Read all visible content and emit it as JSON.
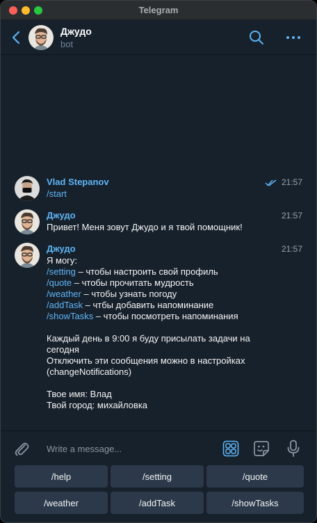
{
  "window": {
    "title": "Telegram"
  },
  "header": {
    "name": "Джудо",
    "status": "bot"
  },
  "messages": [
    {
      "author": "Vlad Stepanov",
      "time": "21:57",
      "read": true,
      "lines": [
        {
          "cmd": "/start",
          "text": ""
        }
      ]
    },
    {
      "author": "Джудо",
      "time": "21:57",
      "lines": [
        {
          "cmd": "",
          "text": "Привет! Меня зовут Джудо и я твой помощник!"
        }
      ]
    },
    {
      "author": "Джудо",
      "time": "21:57",
      "lines": [
        {
          "cmd": "",
          "text": "Я могу:"
        },
        {
          "cmd": "/setting",
          "text": " – чтобы настроить свой профиль"
        },
        {
          "cmd": "/quote",
          "text": " – чтобы прочитать мудрость"
        },
        {
          "cmd": "/weather",
          "text": " – чтобы узнать погоду"
        },
        {
          "cmd": "/addTask",
          "text": " – чтбы добавить напоминание"
        },
        {
          "cmd": "/showTasks",
          "text": " – чтобы посмотреть напоминания"
        },
        {
          "cmd": "",
          "text": ""
        },
        {
          "cmd": "",
          "text": "Каждый день в 9:00 я буду присылать задачи на"
        },
        {
          "cmd": "",
          "text": "сегодня"
        },
        {
          "cmd": "",
          "text": "Отключить эти сообщения можно в настройках"
        },
        {
          "cmd": "",
          "text": "(changeNotifications)"
        },
        {
          "cmd": "",
          "text": ""
        },
        {
          "cmd": "",
          "text": "Твое имя: Влад"
        },
        {
          "cmd": "",
          "text": "Твой город: михайловка"
        }
      ]
    }
  ],
  "composer": {
    "placeholder": "Write a message..."
  },
  "keyboard": {
    "buttons": [
      "/help",
      "/setting",
      "/quote",
      "/weather",
      "/addTask",
      "/showTasks"
    ]
  },
  "colors": {
    "background": "#17212b",
    "accent": "#5eb5f7",
    "button": "#2b394a",
    "text": "#f5f5f5",
    "muted": "#708499"
  },
  "icons": {
    "back": "chevron-left-icon",
    "search": "search-icon",
    "more": "more-dots-icon",
    "read": "double-check-icon",
    "attach": "paperclip-icon",
    "bot_keyboard": "bot-keyboard-icon",
    "sticker": "sticker-icon",
    "mic": "microphone-icon"
  }
}
